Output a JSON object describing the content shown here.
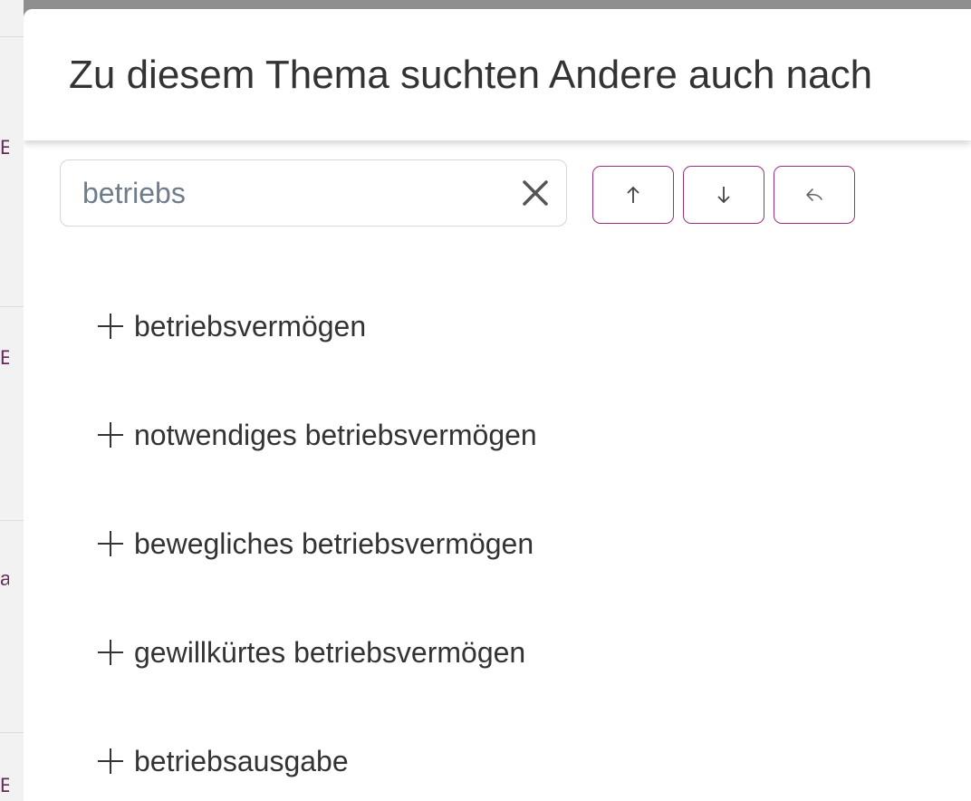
{
  "background": {
    "edge_glyphs": [
      "E",
      "E",
      "a",
      "E"
    ]
  },
  "dialog": {
    "title": "Zu diesem Thema suchten Andere auch nach",
    "search": {
      "value": "betriebs",
      "clear_icon": "close-icon"
    },
    "nav": {
      "up_icon": "arrow-up-icon",
      "down_icon": "arrow-down-icon",
      "reset_icon": "undo-icon"
    },
    "suggestions": [
      {
        "label": "betriebsvermögen"
      },
      {
        "label": "notwendiges betriebsvermögen"
      },
      {
        "label": "bewegliches betriebsvermögen"
      },
      {
        "label": "gewillkürtes betriebsvermögen"
      },
      {
        "label": "betriebsausgabe"
      }
    ]
  },
  "colors": {
    "accent": "#9b2f86",
    "text": "#333333",
    "input_text": "#6e7c8c",
    "overlay": "#8f8f8f"
  }
}
